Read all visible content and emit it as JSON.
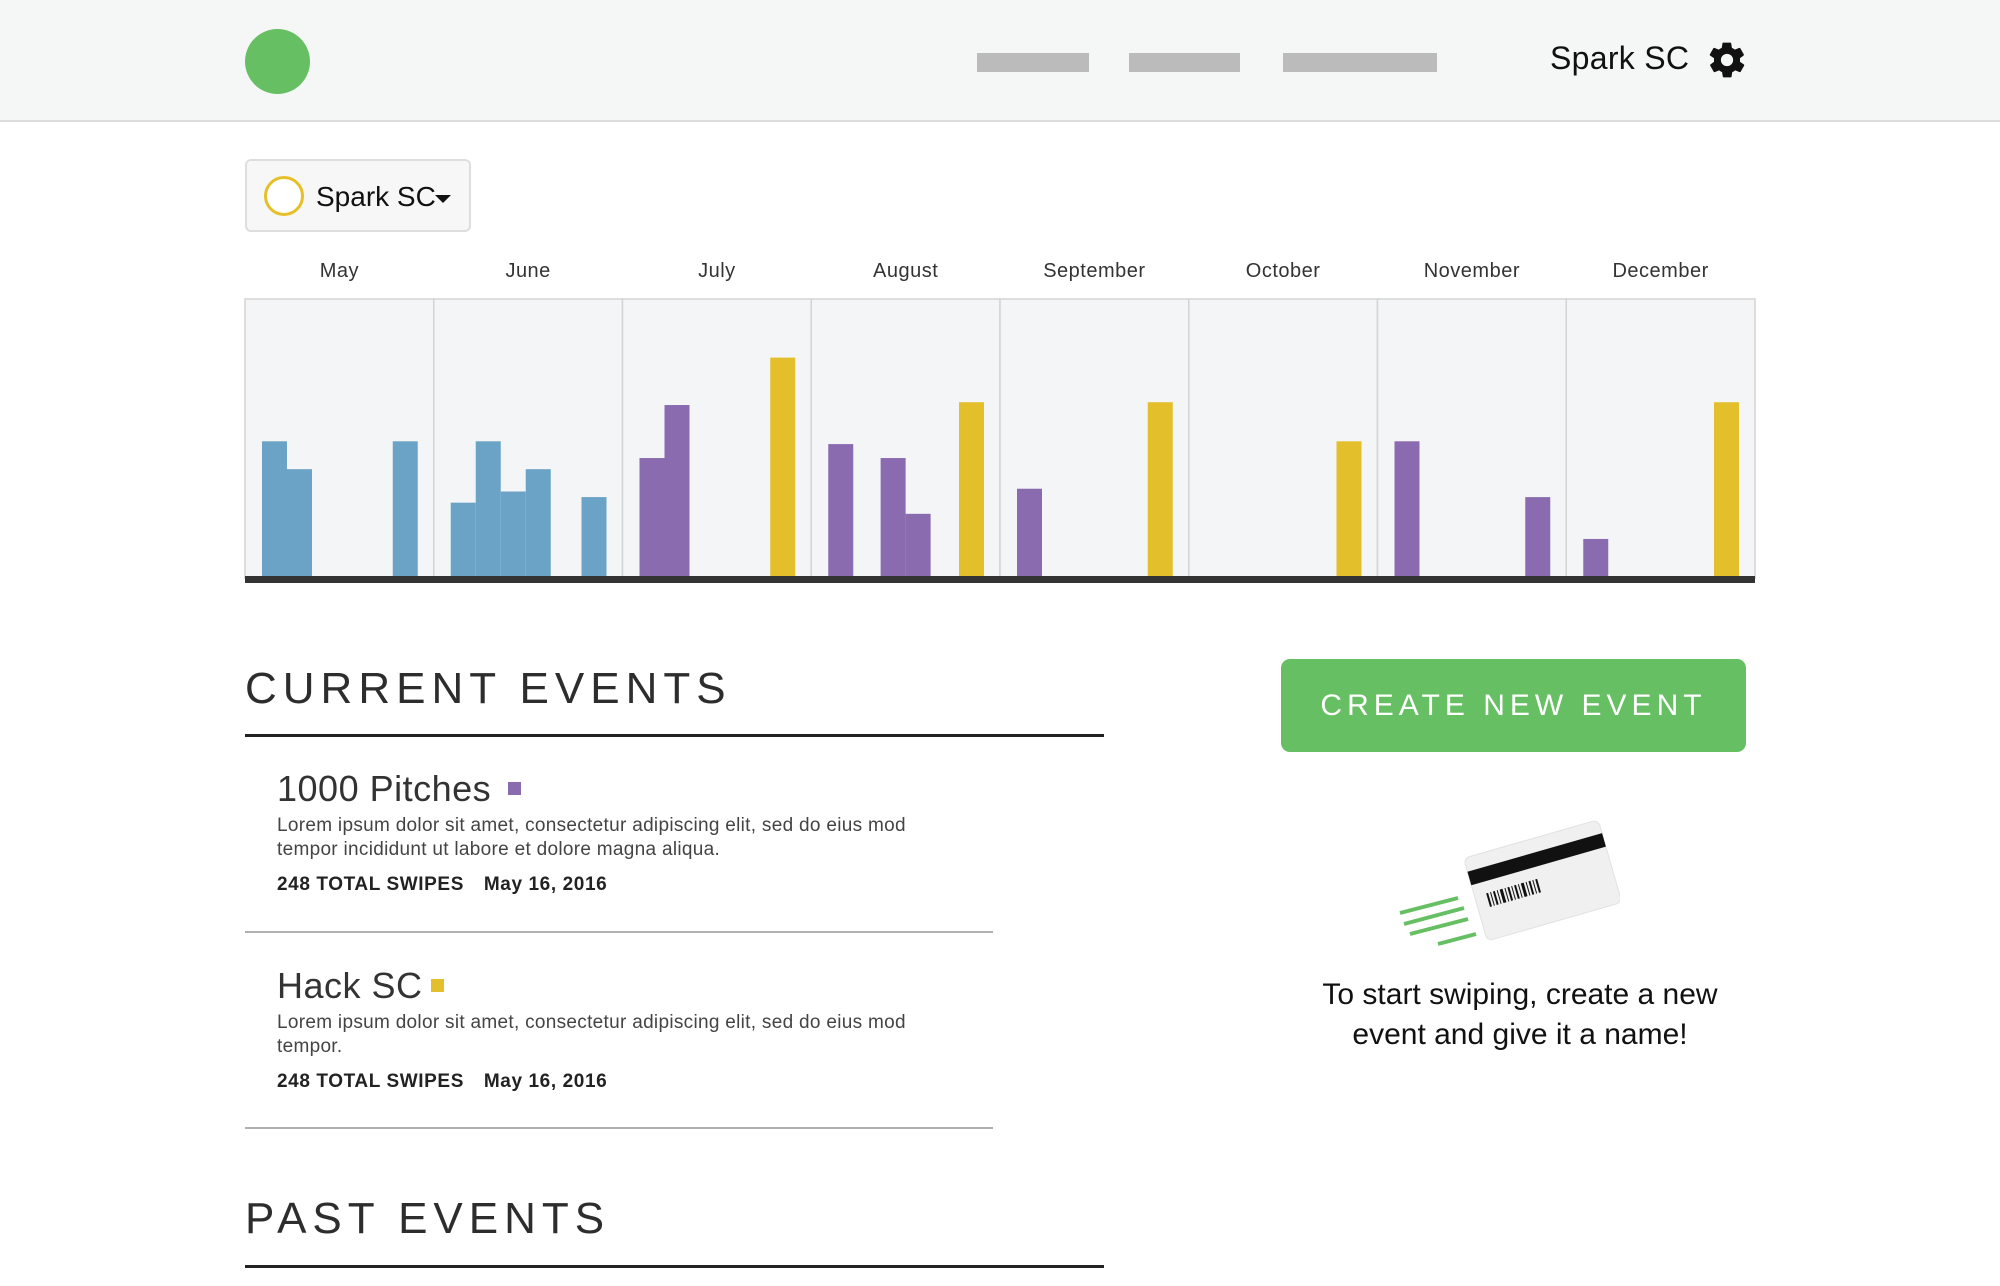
{
  "header": {
    "account_name": "Spark SC",
    "icons": {
      "logo": "green-circle-logo",
      "settings": "gear-icon"
    }
  },
  "org_selector": {
    "label": "Spark SC",
    "icon": "yellow-ring-icon",
    "caret": "caret-down-icon"
  },
  "chart_data": {
    "type": "bar",
    "categories": [
      "May",
      "June",
      "July",
      "August",
      "September",
      "October",
      "November",
      "December"
    ],
    "colors": {
      "blue": "#6aa3c5",
      "purple": "#8b6bb0",
      "yellow": "#e3c02b"
    },
    "months": [
      {
        "bars": [
          {
            "c": "blue",
            "v": [
              49,
              39
            ]
          },
          {
            "c": "blue",
            "v": [
              49
            ]
          }
        ]
      },
      {
        "bars": [
          {
            "c": "blue",
            "v": [
              27,
              49,
              31,
              39
            ]
          },
          {
            "c": "blue",
            "v": [
              29
            ]
          }
        ]
      },
      {
        "bars": [
          {
            "c": "purple",
            "v": [
              43,
              62
            ]
          },
          {
            "c": "yellow",
            "v": [
              79
            ]
          }
        ]
      },
      {
        "bars": [
          {
            "c": "purple",
            "v": [
              48
            ]
          },
          {
            "c": "purple",
            "v": [
              43,
              23
            ]
          },
          {
            "c": "yellow",
            "v": [
              63
            ]
          }
        ]
      },
      {
        "bars": [
          {
            "c": "purple",
            "v": [
              32
            ]
          },
          {
            "c": "yellow",
            "v": [
              63
            ]
          }
        ]
      },
      {
        "bars": [
          {
            "c": "yellow",
            "v": [
              49
            ]
          }
        ]
      },
      {
        "bars": [
          {
            "c": "purple",
            "v": [
              49
            ]
          },
          {
            "c": "purple",
            "v": [
              29
            ]
          }
        ]
      },
      {
        "bars": [
          {
            "c": "purple",
            "v": [
              14
            ]
          },
          {
            "c": "yellow",
            "v": [
              63
            ]
          }
        ]
      }
    ],
    "title": "",
    "xlabel": "",
    "ylabel": "",
    "ylim": [
      0,
      100
    ],
    "grid": false,
    "legend": "none"
  },
  "current_events": {
    "title": "CURRENT EVENTS",
    "items": [
      {
        "name": "1000 Pitches",
        "color": "#8b6bb0",
        "description": "Lorem ipsum dolor sit amet, consectetur adipiscing elit, sed do eius mod tempor incididunt ut labore et dolore magna aliqua.",
        "swipes": "248 TOTAL SWIPES",
        "date": "May 16, 2016"
      },
      {
        "name": "Hack SC",
        "color": "#e3c02b",
        "description": "Lorem ipsum dolor sit amet, consectetur adipiscing elit, sed do eius mod tempor.",
        "swipes": "248 TOTAL SWIPES",
        "date": "May 16, 2016"
      }
    ]
  },
  "past_events": {
    "title": "PAST EVENTS"
  },
  "sidebar": {
    "create_button": "CREATE NEW EVENT",
    "illustration": "swipe-card-icon",
    "empty_message": "To start swiping, create a new event and give it a name!"
  }
}
